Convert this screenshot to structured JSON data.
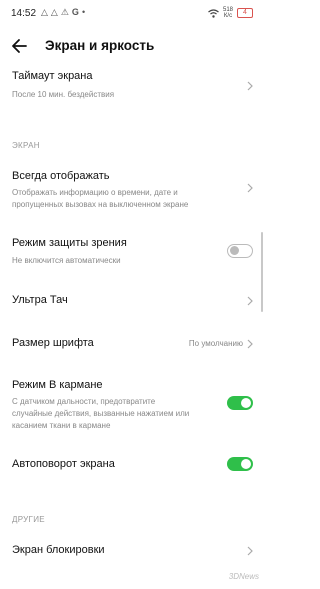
{
  "status": {
    "time": "14:52",
    "left_icons": [
      "△",
      "△",
      "⚠",
      "G",
      "•"
    ],
    "speed_value": "518",
    "speed_unit": "К/с",
    "battery": "4"
  },
  "header": {
    "title": "Экран и яркость"
  },
  "items": {
    "timeout": {
      "title": "Таймаут экрана",
      "subtitle": "После 10 мин. бездействия"
    },
    "section_screen": "ЭКРАН",
    "always_on": {
      "title": "Всегда отображать",
      "subtitle_1": "Отображать информацию о времени, дате и",
      "subtitle_2": "пропущенных вызовах на выключенном экране"
    },
    "eye_protect": {
      "title": "Режим защиты зрения",
      "subtitle": "Не включится автоматически",
      "enabled": false
    },
    "ultra_touch": {
      "title": "Ультра Тач"
    },
    "font_size": {
      "title": "Размер шрифта",
      "value": "По умолчанию"
    },
    "pocket_mode": {
      "title": "Режим В кармане",
      "subtitle_1": "С датчиком дальности, предотвратите",
      "subtitle_2": "случайные действия, вызванные нажатием или",
      "subtitle_3": "касанием ткани в кармане",
      "enabled": true
    },
    "autorotate": {
      "title": "Автоповорот экрана",
      "enabled": true
    },
    "section_other": "ДРУГИЕ",
    "lock_screen": {
      "title": "Экран блокировки"
    }
  },
  "colors": {
    "toggle_on": "#2fbf4a",
    "toggle_off": "#bbbbbb",
    "battery": "#d9534f"
  },
  "watermark": "3DNews"
}
